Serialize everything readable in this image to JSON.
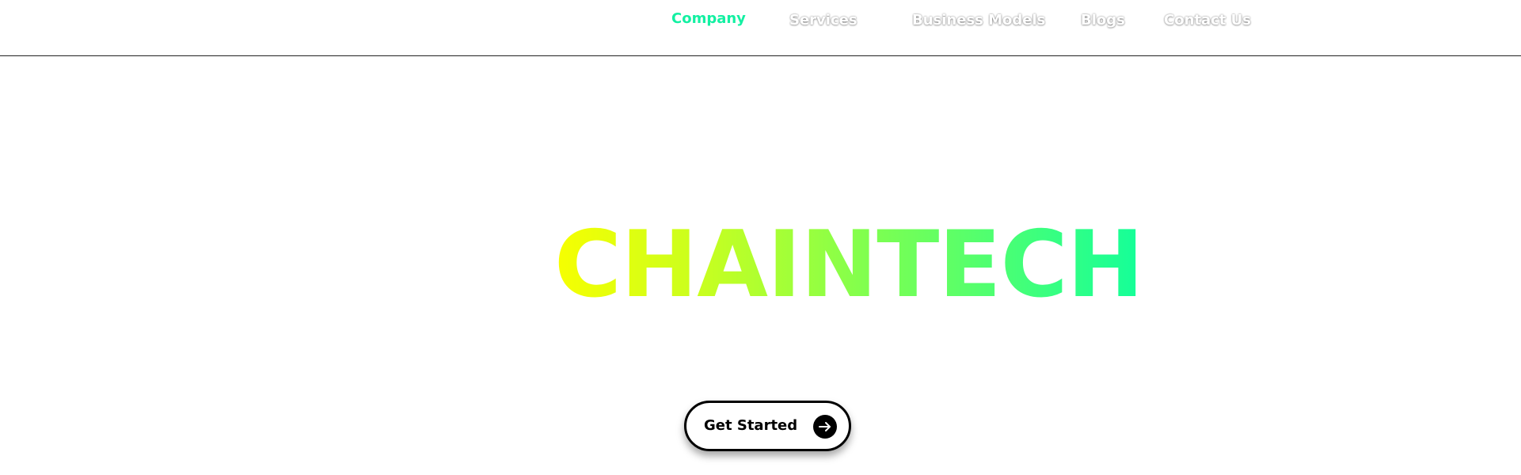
{
  "nav": {
    "items": [
      {
        "label": "Company",
        "active": true
      },
      {
        "label": "Services",
        "active": false
      },
      {
        "label": "Business Models",
        "active": false
      },
      {
        "label": "Blogs",
        "active": false
      },
      {
        "label": "Contact Us",
        "active": false
      }
    ]
  },
  "hero": {
    "title": "CHAINTECH",
    "gradient_colors": [
      "#f7ff00",
      "#13ff9a"
    ],
    "cta_label": "Get Started",
    "cta_icon": "arrow-right-icon"
  },
  "colors": {
    "accent": "#13f0a2",
    "border": "#000000"
  }
}
